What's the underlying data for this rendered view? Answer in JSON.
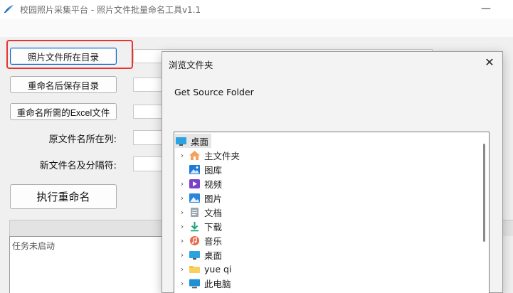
{
  "window": {
    "title": "校园照片采集平台 - 照片文件批量命名工具v1.1",
    "minimize_glyph": "—"
  },
  "form": {
    "photo_dir_button": "照片文件所在目录",
    "save_dir_button": "重命名后保存目录",
    "excel_button": "重命名所需的Excel文件",
    "source_col_label": "原文件名所在列:",
    "new_name_label": "新文件名及分隔符:",
    "run_button": "执行重命名",
    "log_status": "任务未启动"
  },
  "dialog": {
    "title": "浏览文件夹",
    "close_glyph": "✕",
    "description": "Get Source Folder",
    "tree": [
      {
        "label": "桌面",
        "icon": "desktop-icon",
        "expandable": false,
        "selected": true
      },
      {
        "label": "主文件夹",
        "icon": "home-icon",
        "expandable": true
      },
      {
        "label": "图库",
        "icon": "gallery-icon",
        "expandable": false
      },
      {
        "label": "视频",
        "icon": "videos-icon",
        "expandable": true
      },
      {
        "label": "图片",
        "icon": "pictures-icon",
        "expandable": true
      },
      {
        "label": "文档",
        "icon": "documents-icon",
        "expandable": true
      },
      {
        "label": "下载",
        "icon": "downloads-icon",
        "expandable": true
      },
      {
        "label": "音乐",
        "icon": "music-icon",
        "expandable": true
      },
      {
        "label": "桌面",
        "icon": "desktop-icon",
        "expandable": true
      },
      {
        "label": "yue qi",
        "icon": "folder-icon",
        "expandable": true
      },
      {
        "label": "此电脑",
        "icon": "computer-icon",
        "expandable": true
      }
    ]
  },
  "colors": {
    "highlight": "#e8332e",
    "accent": "#0a64c8"
  }
}
